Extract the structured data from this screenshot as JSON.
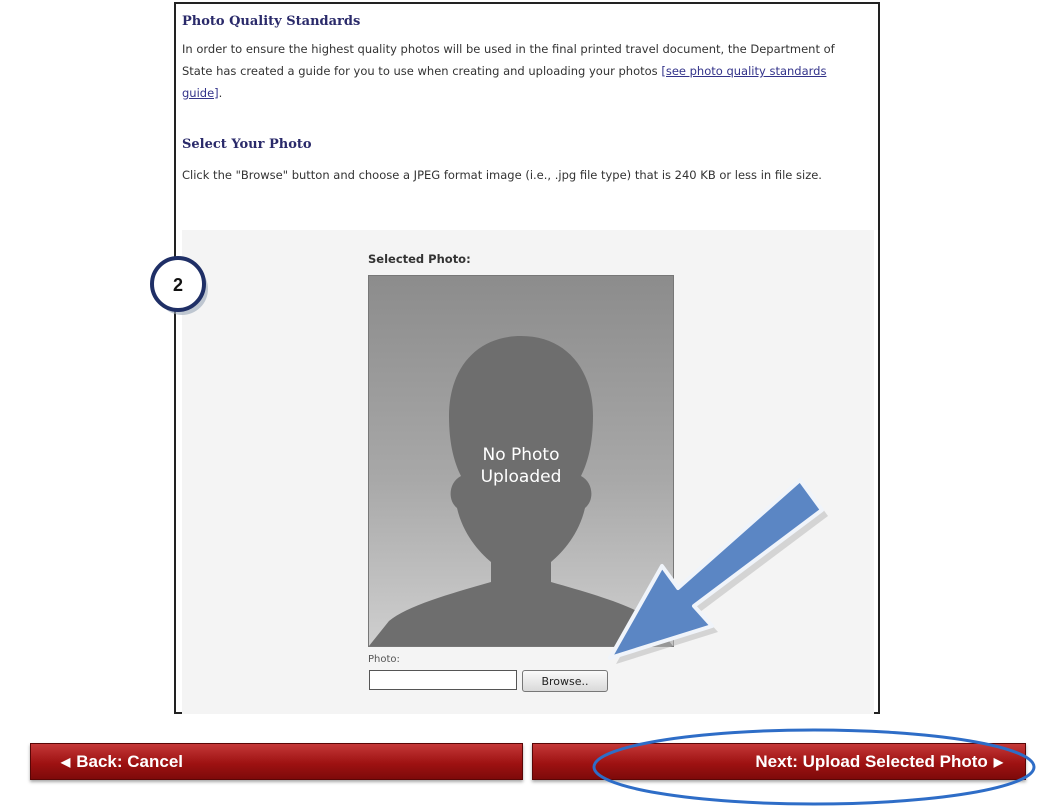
{
  "photo_quality": {
    "heading": "Photo Quality Standards",
    "text": "In order to ensure the highest quality photos will be used in the final printed travel document, the Department of State has created a guide for you to use when creating and uploading your photos",
    "link_text": "[see photo quality standards guide]",
    "text_end": "."
  },
  "select_photo": {
    "heading": "Select Your Photo",
    "text": "Click the \"Browse\" button and choose a JPEG format image (i.e., .jpg file type) that is 240 KB or less in file size."
  },
  "photo_panel": {
    "selected_label": "Selected Photo:",
    "no_photo_line1": "No Photo",
    "no_photo_line2": "Uploaded",
    "field_label": "Photo:",
    "file_value": "",
    "browse_label": "Browse.."
  },
  "step_marker": {
    "number": "2"
  },
  "navigation": {
    "back_label": "Back: Cancel",
    "next_label": "Next: Upload Selected Photo"
  },
  "colors": {
    "button_red": "#9e1212",
    "heading_navy": "#2a2a6a",
    "arrow_blue": "#5b86c4",
    "marker_navy": "#1f2f66"
  },
  "icons": {
    "back_caret": "caret-left-icon",
    "next_caret": "caret-right-icon",
    "callout_arrow": "pointer-arrow-icon",
    "silhouette": "person-silhouette-icon"
  }
}
